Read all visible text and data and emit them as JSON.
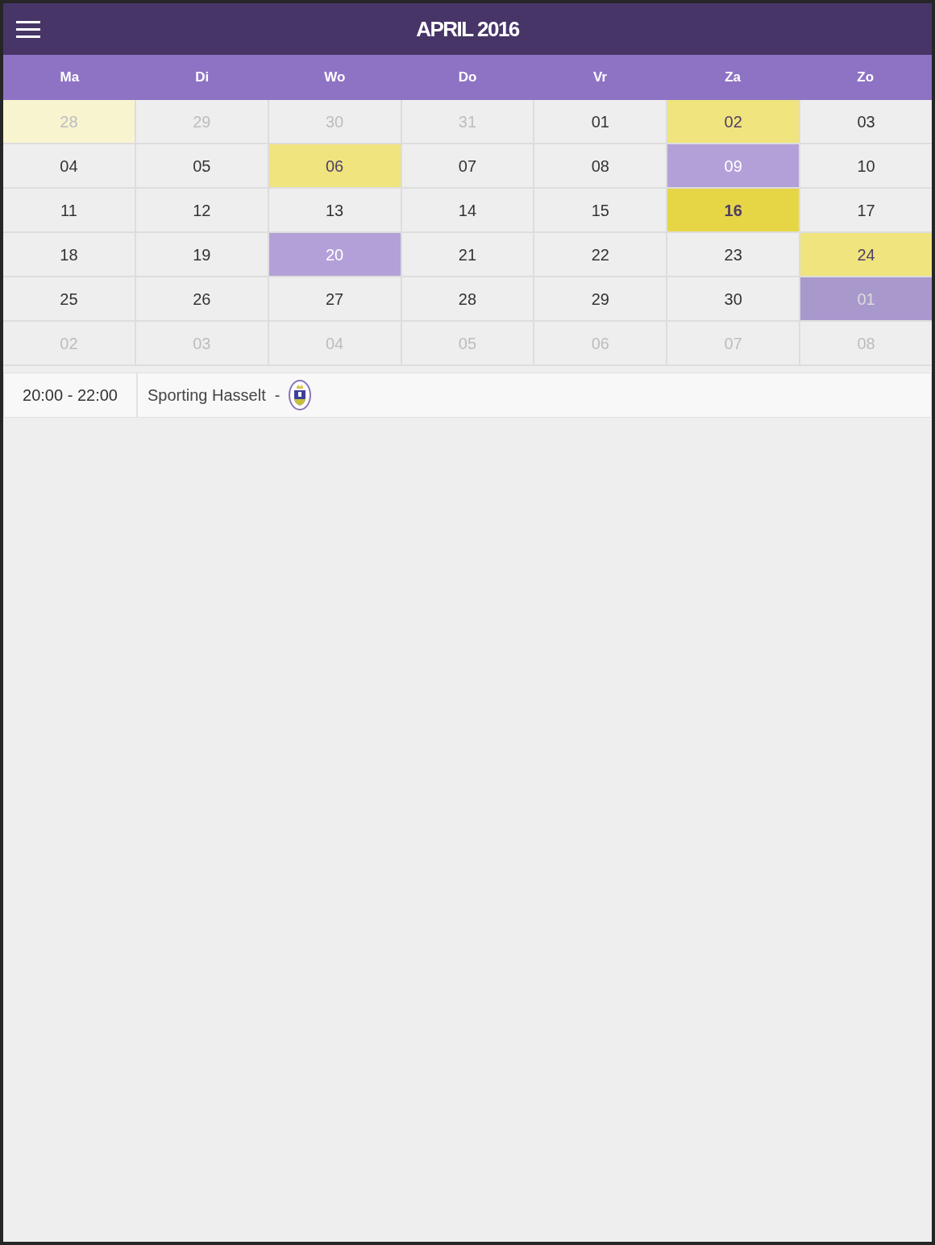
{
  "header": {
    "title": "APRIL 2016"
  },
  "weekdays": [
    "Ma",
    "Di",
    "Wo",
    "Do",
    "Vr",
    "Za",
    "Zo"
  ],
  "weeks": [
    [
      {
        "label": "28",
        "outside_month": true,
        "selected": false,
        "color": "#f8f4d0"
      },
      {
        "label": "29",
        "outside_month": true,
        "selected": false
      },
      {
        "label": "30",
        "outside_month": true,
        "selected": false
      },
      {
        "label": "31",
        "outside_month": true,
        "selected": false
      },
      {
        "label": "01",
        "outside_month": false,
        "selected": false
      },
      {
        "label": "02",
        "outside_month": false,
        "selected": false,
        "color": "#f0e47e"
      },
      {
        "label": "03",
        "outside_month": false,
        "selected": false
      }
    ],
    [
      {
        "label": "04",
        "outside_month": false,
        "selected": false
      },
      {
        "label": "05",
        "outside_month": false,
        "selected": false
      },
      {
        "label": "06",
        "outside_month": false,
        "selected": false,
        "color": "#f0e47e"
      },
      {
        "label": "07",
        "outside_month": false,
        "selected": false
      },
      {
        "label": "08",
        "outside_month": false,
        "selected": false
      },
      {
        "label": "09",
        "outside_month": false,
        "selected": false,
        "color": "#b3a0d8"
      },
      {
        "label": "10",
        "outside_month": false,
        "selected": false
      }
    ],
    [
      {
        "label": "11",
        "outside_month": false,
        "selected": false
      },
      {
        "label": "12",
        "outside_month": false,
        "selected": false
      },
      {
        "label": "13",
        "outside_month": false,
        "selected": false
      },
      {
        "label": "14",
        "outside_month": false,
        "selected": false
      },
      {
        "label": "15",
        "outside_month": false,
        "selected": false
      },
      {
        "label": "16",
        "outside_month": false,
        "selected": true,
        "color": "#e6d646"
      },
      {
        "label": "17",
        "outside_month": false,
        "selected": false
      }
    ],
    [
      {
        "label": "18",
        "outside_month": false,
        "selected": false
      },
      {
        "label": "19",
        "outside_month": false,
        "selected": false
      },
      {
        "label": "20",
        "outside_month": false,
        "selected": false,
        "color": "#b3a0d8"
      },
      {
        "label": "21",
        "outside_month": false,
        "selected": false
      },
      {
        "label": "22",
        "outside_month": false,
        "selected": false
      },
      {
        "label": "23",
        "outside_month": false,
        "selected": false
      },
      {
        "label": "24",
        "outside_month": false,
        "selected": false,
        "color": "#f0e47e"
      }
    ],
    [
      {
        "label": "25",
        "outside_month": false,
        "selected": false
      },
      {
        "label": "26",
        "outside_month": false,
        "selected": false
      },
      {
        "label": "27",
        "outside_month": false,
        "selected": false
      },
      {
        "label": "28",
        "outside_month": false,
        "selected": false
      },
      {
        "label": "29",
        "outside_month": false,
        "selected": false
      },
      {
        "label": "30",
        "outside_month": false,
        "selected": false
      },
      {
        "label": "01",
        "outside_month": true,
        "selected": false,
        "color": "#a998cc"
      }
    ],
    [
      {
        "label": "02",
        "outside_month": true,
        "selected": false
      },
      {
        "label": "03",
        "outside_month": true,
        "selected": false
      },
      {
        "label": "04",
        "outside_month": true,
        "selected": false
      },
      {
        "label": "05",
        "outside_month": true,
        "selected": false
      },
      {
        "label": "06",
        "outside_month": true,
        "selected": false
      },
      {
        "label": "07",
        "outside_month": true,
        "selected": false
      },
      {
        "label": "08",
        "outside_month": true,
        "selected": false
      }
    ]
  ],
  "events": [
    {
      "time": "20:00 - 22:00",
      "title": "Sporting Hasselt  -"
    }
  ]
}
